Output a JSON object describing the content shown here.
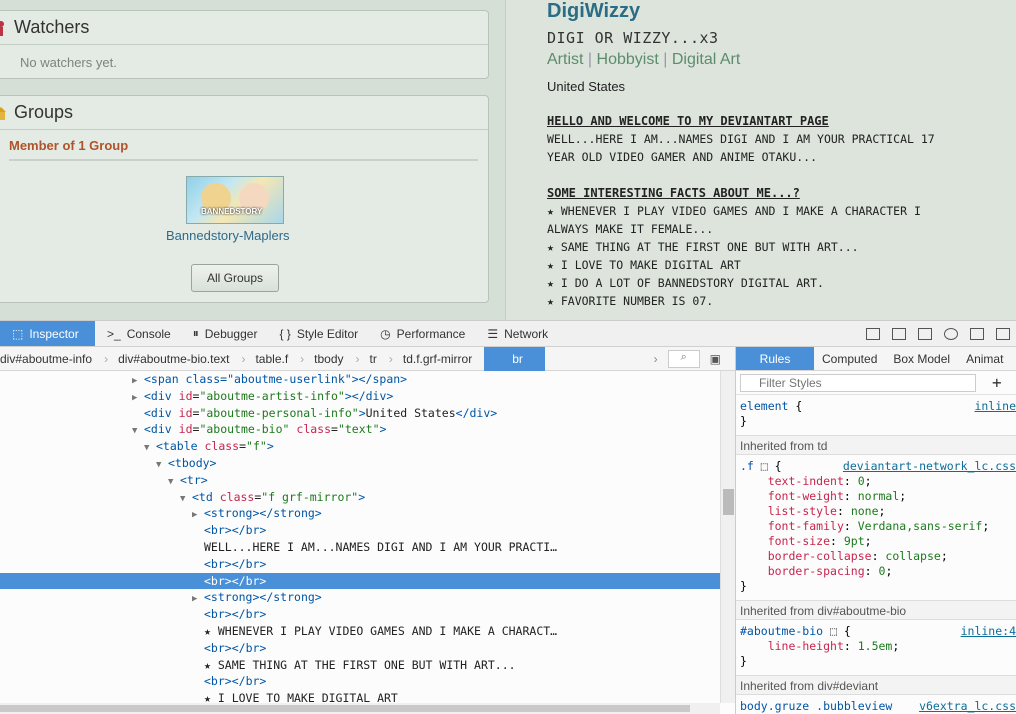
{
  "watchers": {
    "title": "Watchers",
    "empty_text": "No watchers yet."
  },
  "groups": {
    "title": "Groups",
    "member_label": "Member of 1 Group",
    "group_name": "Bannedstory-Maplers",
    "thumb_text": "BANNEDSTORY",
    "all_groups_label": "All Groups"
  },
  "profile": {
    "username": "DigiWizzy",
    "tagline": "DIGI OR WIZZY...x3",
    "role_artist": "Artist",
    "role_hobbyist": "Hobbyist",
    "role_digital": "Digital Art",
    "separator": "|",
    "location": "United States",
    "bio_lines": [
      "HELLO AND WELCOME TO MY DEVIANTART PAGE",
      "WELL...HERE I AM...NAMES DIGI AND I AM YOUR PRACTICAL 17",
      "YEAR OLD VIDEO GAMER AND ANIME OTAKU...",
      "",
      "SOME INTERESTING FACTS ABOUT ME...?",
      "★ WHENEVER I PLAY VIDEO GAMES AND I MAKE A CHARACTER I",
      "ALWAYS MAKE IT FEMALE...",
      "★ SAME THING AT THE FIRST ONE BUT WITH ART...",
      "★ I LOVE TO MAKE DIGITAL ART",
      "★ I DO A LOT OF BANNEDSTORY DIGITAL ART.",
      "★ FAVORITE NUMBER IS 07."
    ]
  },
  "devtools": {
    "tabs": [
      "Inspector",
      "Console",
      "Debugger",
      "Style Editor",
      "Performance",
      "Network"
    ],
    "breadcrumbs": [
      "div#aboutme-info",
      "div#aboutme-bio.text",
      "table.f",
      "tbody",
      "tr",
      "td.f.grf-mirror",
      "br"
    ],
    "markup_lines": [
      {
        "indent": 12,
        "twisty": "▶",
        "html": "<span class=\"aboutme-userlink\"></span>"
      },
      {
        "indent": 12,
        "twisty": "▶",
        "tag": "div",
        "id": "aboutme-artist-info",
        "close": true
      },
      {
        "indent": 12,
        "twisty": "",
        "tag": "div",
        "id": "aboutme-personal-info",
        "text": "United States",
        "close": true
      },
      {
        "indent": 12,
        "twisty": "▼",
        "tag": "div",
        "id": "aboutme-bio",
        "cls": "text"
      },
      {
        "indent": 13,
        "twisty": "▼",
        "tag": "table",
        "cls": "f"
      },
      {
        "indent": 14,
        "twisty": "▼",
        "tag": "tbody"
      },
      {
        "indent": 15,
        "twisty": "▼",
        "tag": "tr"
      },
      {
        "indent": 16,
        "twisty": "▼",
        "tag": "td",
        "cls": "f grf-mirror"
      },
      {
        "indent": 17,
        "twisty": "▶",
        "tag": "strong",
        "close": true
      },
      {
        "indent": 17,
        "twisty": "",
        "tag": "br",
        "close": true
      },
      {
        "indent": 17,
        "twisty": "",
        "text_only": "WELL...HERE I AM...NAMES DIGI AND I AM YOUR PRACTI…"
      },
      {
        "indent": 17,
        "twisty": "",
        "tag": "br",
        "close": true
      },
      {
        "indent": 17,
        "twisty": "",
        "tag": "br",
        "close": true,
        "selected": true
      },
      {
        "indent": 17,
        "twisty": "▶",
        "tag": "strong",
        "close": true
      },
      {
        "indent": 17,
        "twisty": "",
        "tag": "br",
        "close": true
      },
      {
        "indent": 17,
        "twisty": "",
        "text_only": "★ WHENEVER I PLAY VIDEO GAMES AND I MAKE A CHARACT…"
      },
      {
        "indent": 17,
        "twisty": "",
        "tag": "br",
        "close": true
      },
      {
        "indent": 17,
        "twisty": "",
        "text_only": "★ SAME THING AT THE FIRST ONE BUT WITH ART..."
      },
      {
        "indent": 17,
        "twisty": "",
        "tag": "br",
        "close": true
      },
      {
        "indent": 17,
        "twisty": "",
        "text_only": "★ I LOVE TO MAKE DIGITAL ART"
      }
    ],
    "rules_tabs": [
      "Rules",
      "Computed",
      "Box Model",
      "Animat"
    ],
    "filter_placeholder": "Filter Styles",
    "element_rule": {
      "selector": "element",
      "source": "inline"
    },
    "inherited_td": "Inherited from td",
    "rule_f": {
      "selector": ".f",
      "source": "deviantart-network_lc.css",
      "props": [
        [
          "text-indent",
          "0"
        ],
        [
          "font-weight",
          "normal"
        ],
        [
          "list-style",
          "none"
        ],
        [
          "font-family",
          "Verdana,sans-serif"
        ],
        [
          "font-size",
          "9pt"
        ],
        [
          "border-collapse",
          "collapse"
        ],
        [
          "border-spacing",
          "0"
        ]
      ]
    },
    "inherited_bio": "Inherited from div#aboutme-bio",
    "rule_bio": {
      "selector": "#aboutme-bio",
      "source": "inline:4",
      "props": [
        [
          "line-height",
          "1.5em"
        ]
      ]
    },
    "inherited_deviant": "Inherited from div#deviant",
    "rule_body": {
      "selector": "body.gruze .bubbleview",
      "source": "v6extra_lc.css"
    }
  }
}
